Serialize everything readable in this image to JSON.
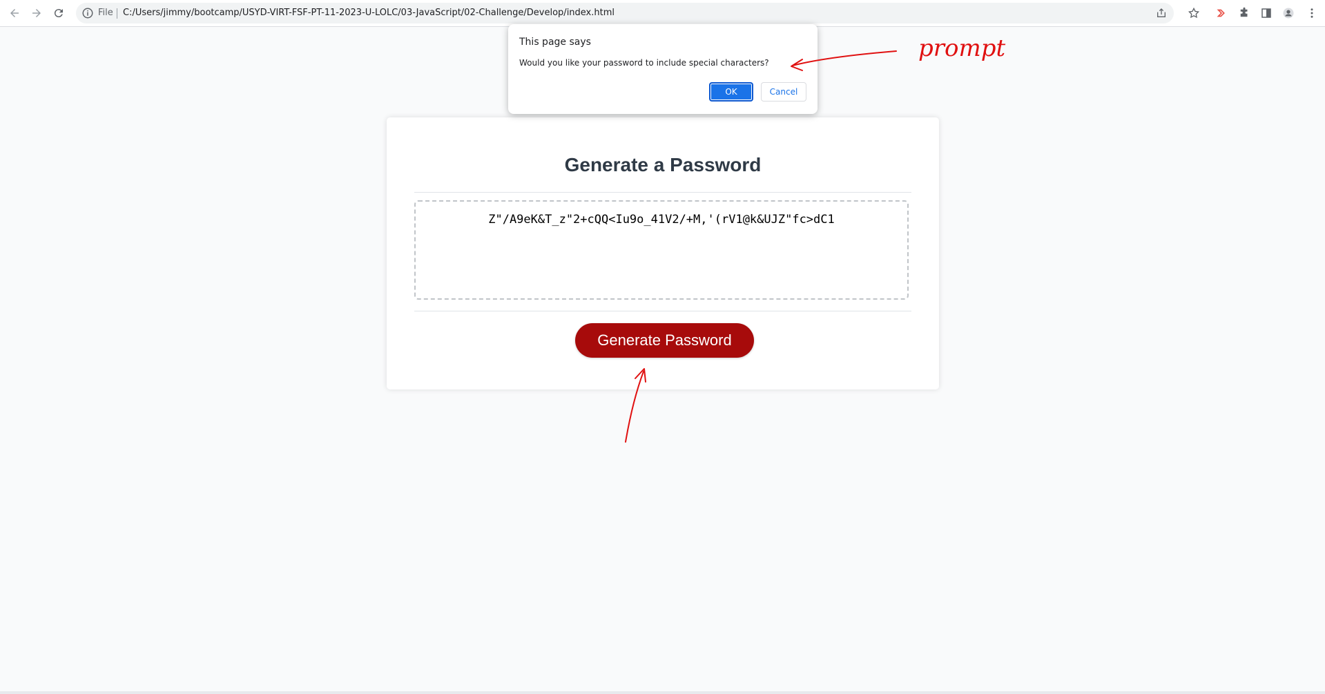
{
  "browser": {
    "scheme_label": "File",
    "url": "C:/Users/jimmy/bootcamp/USYD-VIRT-FSF-PT-11-2023-U-LOLC/03-JavaScript/02-Challenge/Develop/index.html",
    "icons": [
      "back-arrow-icon",
      "forward-arrow-icon",
      "reload-icon",
      "info-icon",
      "share-icon",
      "star-icon",
      "extension-red-icon",
      "puzzle-icon",
      "side-panel-icon",
      "profile-icon",
      "menu-kebab-icon"
    ]
  },
  "page": {
    "title": "Generate a Password",
    "password_value": "Z\"/A9eK&T_z\"2+cQQ<Iu9o_41V2/+M,'(rV1@k&UJZ\"fc>dC1",
    "button_label": "Generate Password"
  },
  "dialog": {
    "title": "This page says",
    "message": "Would you like your password to include special characters?",
    "ok_label": "OK",
    "cancel_label": "Cancel"
  },
  "annotation": {
    "label": "prompt",
    "color": "#e01010"
  },
  "colors": {
    "button": "#a70b0b",
    "dialog_ok": "#1a73e8",
    "page_bg": "#f9fafb",
    "title": "#2f3a46"
  }
}
